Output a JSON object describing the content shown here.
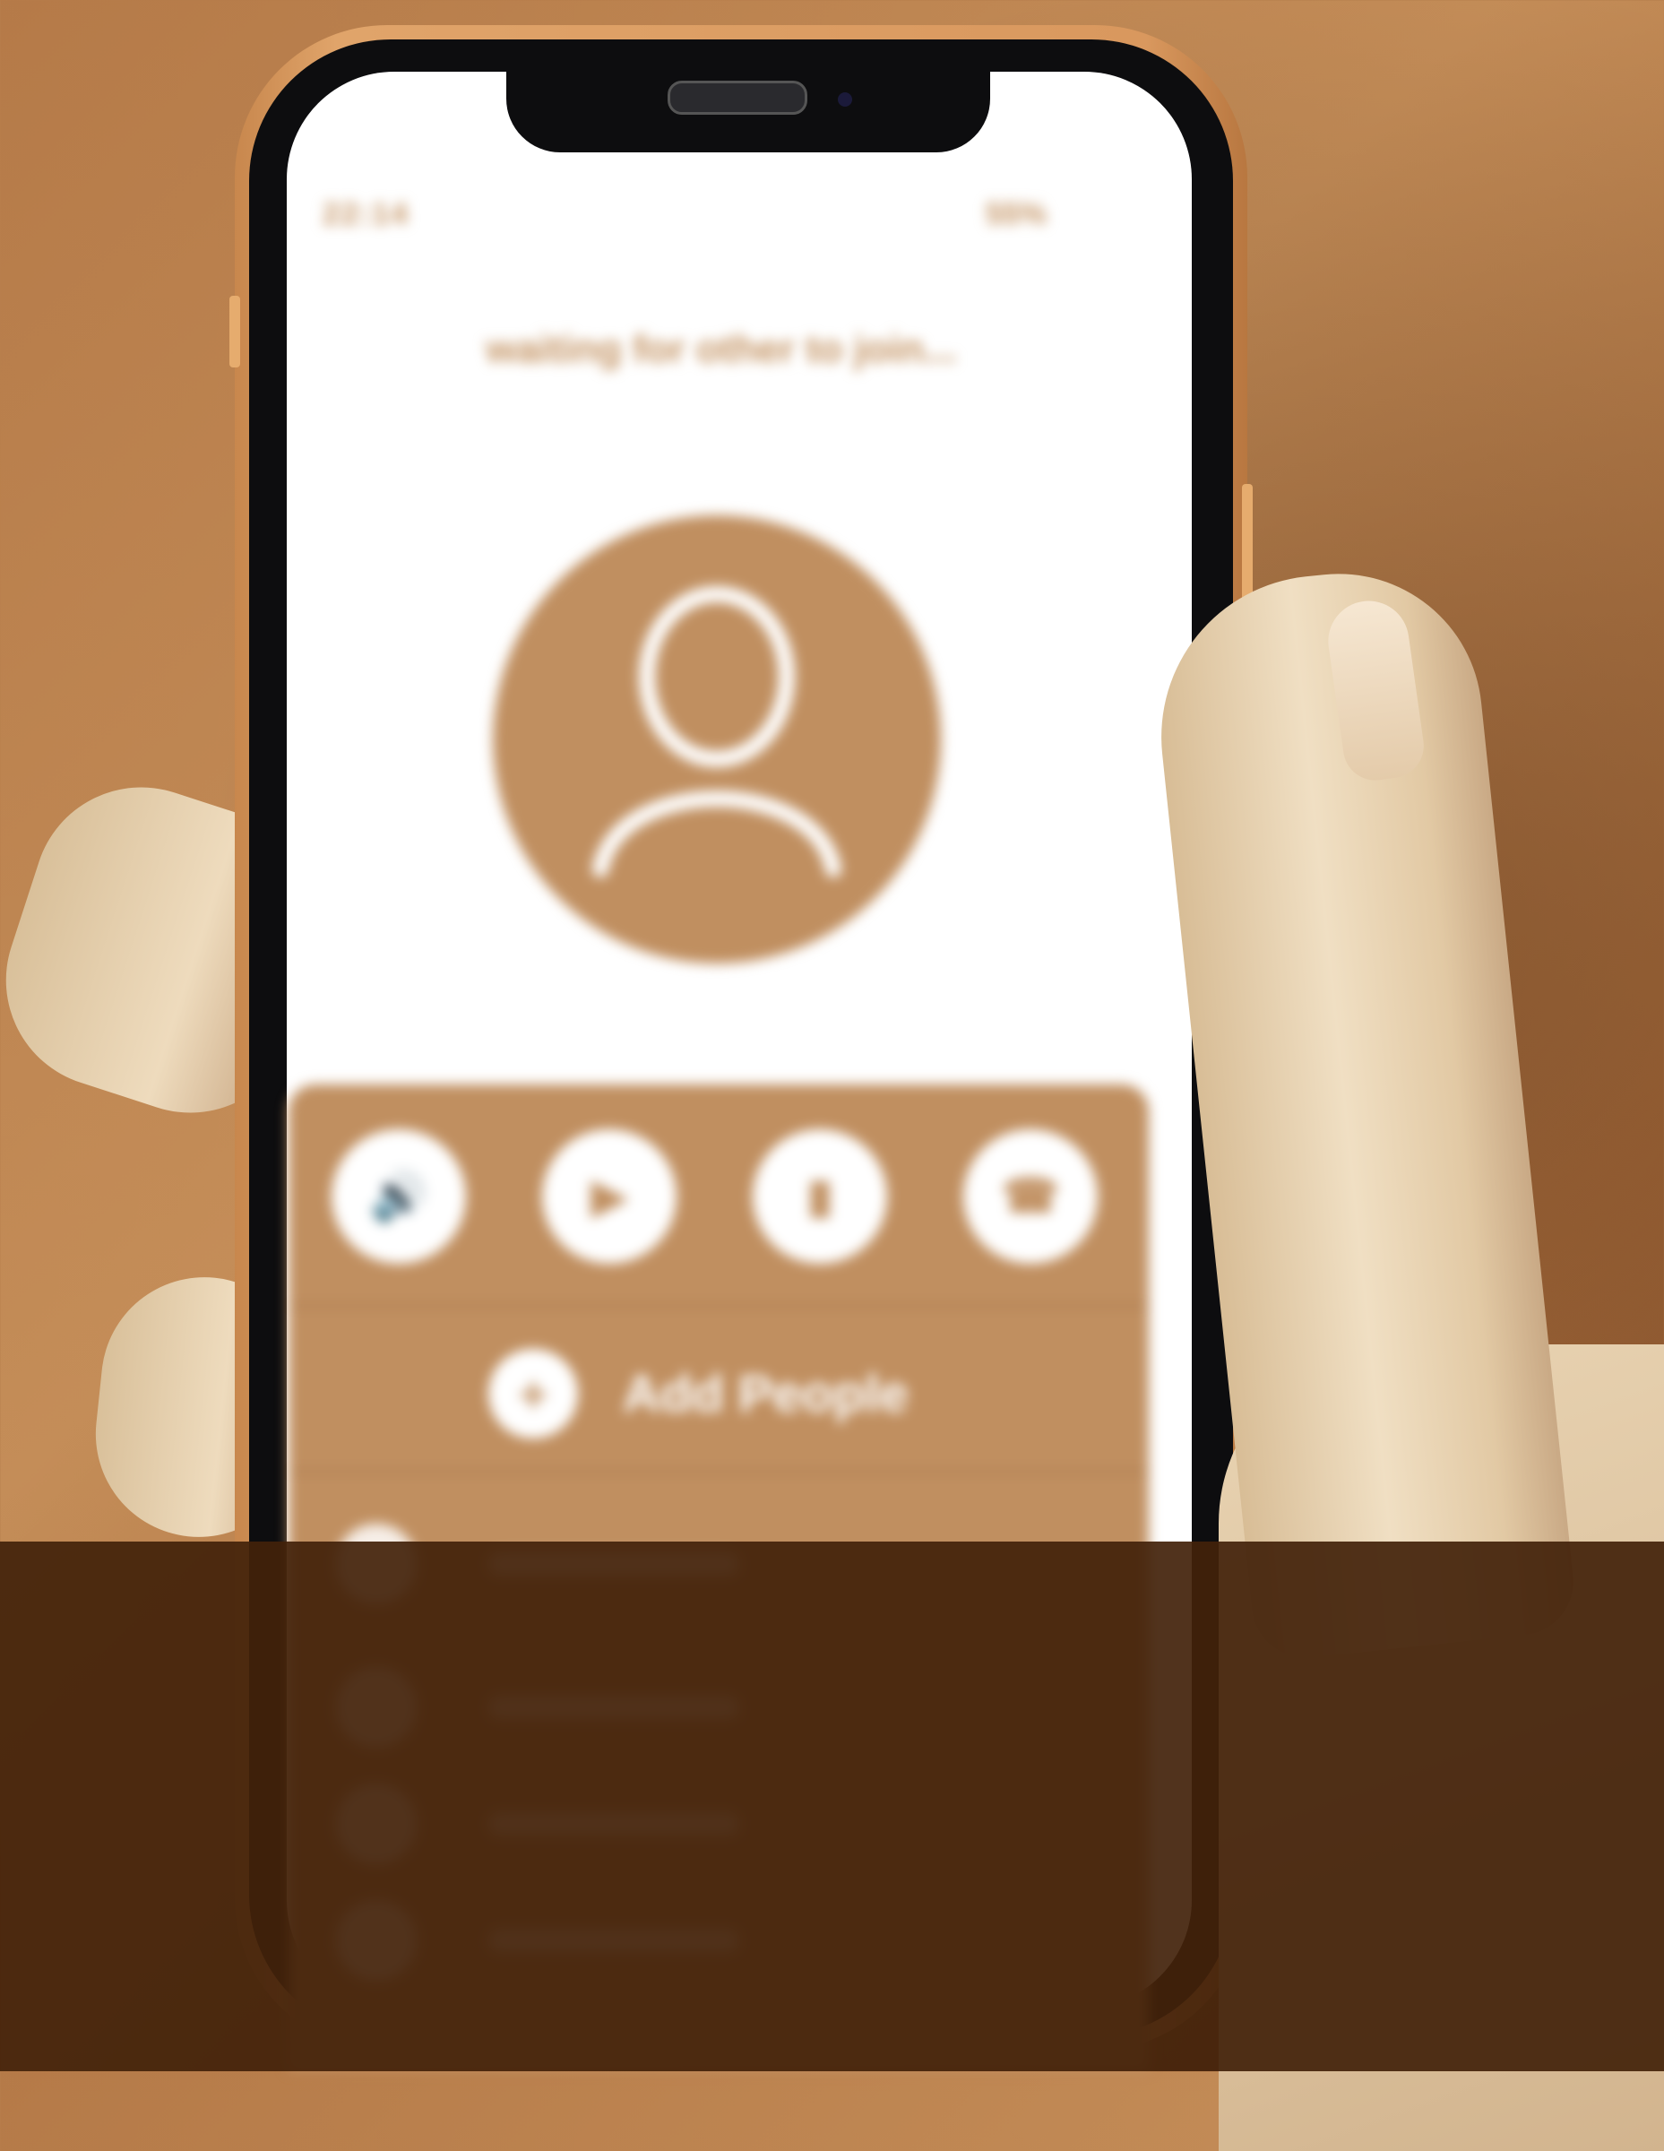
{
  "colors": {
    "wall": "#c48d58",
    "accent_tan": "#c08f60",
    "screen_bg": "#ffffff",
    "overlay_band": "#42220a"
  },
  "status_bar": {
    "time": "22:14",
    "battery": "55%"
  },
  "call": {
    "status_text": "waiting for other to join..."
  },
  "avatar": {
    "icon": "person-icon"
  },
  "controls": [
    {
      "name": "speaker",
      "icon": "speaker-icon",
      "glyph": "🔊"
    },
    {
      "name": "video",
      "icon": "video-icon",
      "glyph": "▶"
    },
    {
      "name": "mute",
      "icon": "microphone-icon",
      "glyph": "▮"
    },
    {
      "name": "end-call",
      "icon": "end-call-icon",
      "glyph": "☎"
    }
  ],
  "add_people": {
    "label": "Add People",
    "icon": "add-person-icon",
    "glyph": "+"
  }
}
